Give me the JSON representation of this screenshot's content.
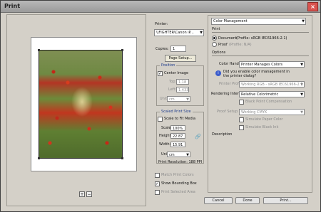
{
  "window": {
    "title": "Print"
  },
  "printer": {
    "label": "Printer:",
    "value": "\\\\FIGHTER\\Canon iP...",
    "copies_label": "Copies:",
    "copies_value": "1",
    "page_setup": "Page Setup..."
  },
  "position": {
    "title": "Position",
    "center_image": "Center Image",
    "top_label": "Top:",
    "top_value": "1.18",
    "left_label": "Left:",
    "left_value": "1.433",
    "unit_label": "Unit:",
    "unit_value": "cm"
  },
  "scaled": {
    "title": "Scaled Print Size",
    "scale_to_fit": "Scale to Fit Media",
    "scale_label": "Scale:",
    "scale_value": "100%",
    "height_label": "Height:",
    "height_value": "22.87",
    "width_label": "Width:",
    "width_value": "15.91",
    "unit_label": "Unit:",
    "unit_value": "cm",
    "resolution": "Print Resolution: 188 PPI"
  },
  "options": {
    "match_print_colors": "Match Print Colors",
    "show_bounding_box": "Show Bounding Box",
    "print_selected_area": "Print Selected Area"
  },
  "color": {
    "dropdown": "Color Management",
    "print_label": "Print",
    "document_label": "Document",
    "document_profile": "(Profile: sRGB IEC61966-2.1)",
    "proof_label": "Proof",
    "proof_profile": "(Profile: N/A)",
    "options_label": "Options",
    "handling_label": "Color Handling:",
    "handling_value": "Printer Manages Colors",
    "info_text": "Did you enable color management in the printer dialog?",
    "printer_profile_label": "Printer Profile:",
    "printer_profile_value": "Working RGB - sRGB IEC61966-2.1",
    "intent_label": "Rendering Intent:",
    "intent_value": "Relative Colorimetric",
    "black_point": "Black Point Compensation",
    "proof_setup_label": "Proof Setup:",
    "proof_setup_value": "Working CMYK",
    "simulate_paper": "Simulate Paper Color",
    "simulate_black": "Simulate Black Ink",
    "description_label": "Description"
  },
  "buttons": {
    "cancel": "Cancel",
    "done": "Done",
    "print": "Print..."
  }
}
